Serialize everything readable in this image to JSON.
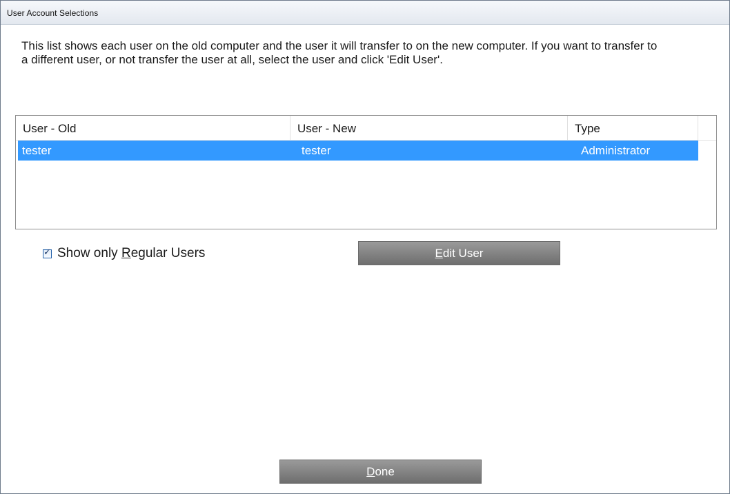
{
  "window": {
    "title": "User Account Selections"
  },
  "intro": {
    "text": "This list shows each user on the old computer and the user it will transfer to on the new computer. If you want to transfer to a different user, or not transfer the user at all, select the user and click 'Edit User'."
  },
  "table": {
    "columns": [
      "User - Old",
      "User - New",
      "Type"
    ],
    "rows": [
      {
        "old": "tester",
        "new": "tester",
        "type": "Administrator",
        "selected": true
      }
    ]
  },
  "controls": {
    "show_regular_checked": true,
    "show_regular_prefix": "Show only ",
    "show_regular_mnemonic": "R",
    "show_regular_suffix": "egular Users",
    "edit_mnemonic": "E",
    "edit_suffix": "dit User",
    "done_mnemonic": "D",
    "done_suffix": "one"
  },
  "colors": {
    "selection": "#3399ff",
    "button": "#7f7f7f"
  }
}
